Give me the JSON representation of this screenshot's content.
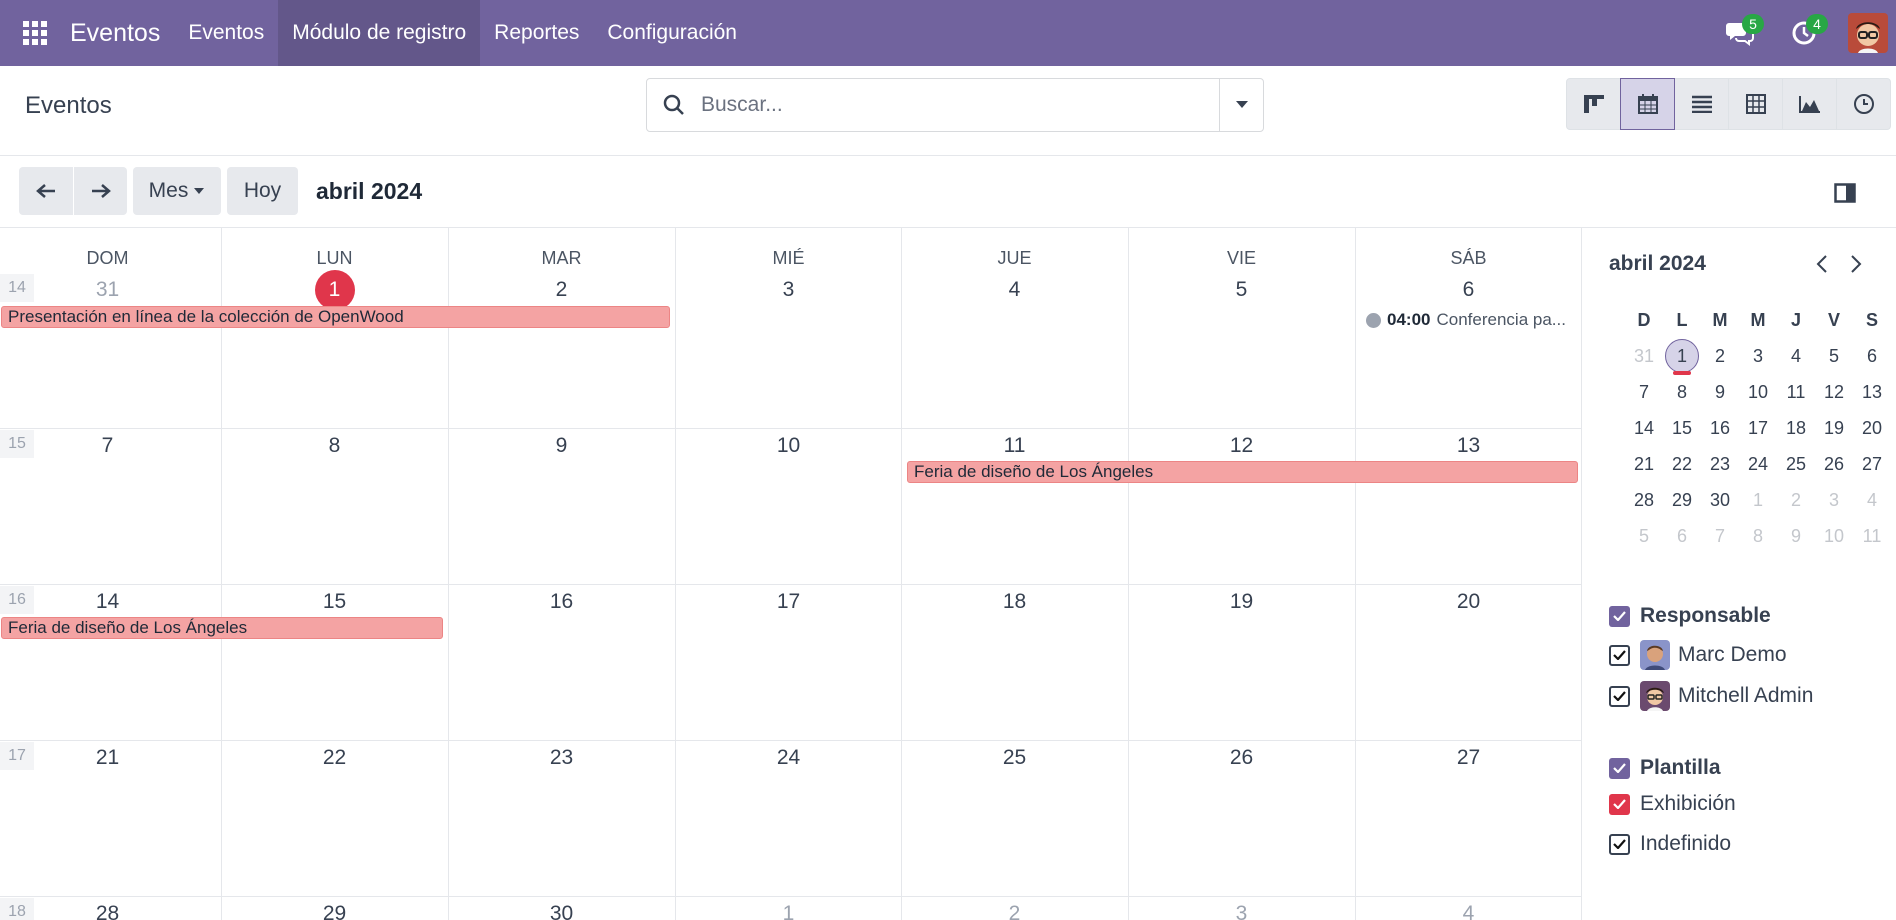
{
  "topnav": {
    "brand": "Eventos",
    "items": [
      "Eventos",
      "Módulo de registro",
      "Reportes",
      "Configuración"
    ],
    "active_index": 1,
    "messages_badge": "5",
    "activities_badge": "4",
    "bg_color": "#71639e"
  },
  "control": {
    "title": "Eventos",
    "search_placeholder": "Buscar...",
    "views": [
      "kanban-view-icon",
      "calendar-view-icon",
      "list-view-icon",
      "pivot-view-icon",
      "graph-view-icon",
      "activity-view-icon"
    ],
    "active_view": "calendar-view-icon"
  },
  "toolbar": {
    "scale_label": "Mes",
    "today_label": "Hoy",
    "current_range": "abril 2024"
  },
  "calendar": {
    "weekdays": [
      "DOM",
      "LUN",
      "MAR",
      "MIÉ",
      "JUE",
      "VIE",
      "SÁB"
    ],
    "weeks": [
      {
        "num": "14",
        "days": [
          "31",
          "1",
          "2",
          "3",
          "4",
          "5",
          "6"
        ]
      },
      {
        "num": "15",
        "days": [
          "7",
          "8",
          "9",
          "10",
          "11",
          "12",
          "13"
        ]
      },
      {
        "num": "16",
        "days": [
          "14",
          "15",
          "16",
          "17",
          "18",
          "19",
          "20"
        ]
      },
      {
        "num": "17",
        "days": [
          "21",
          "22",
          "23",
          "24",
          "25",
          "26",
          "27"
        ]
      },
      {
        "num": "18",
        "days": [
          "28",
          "29",
          "30",
          "1",
          "2",
          "3",
          "4"
        ]
      }
    ],
    "today": "1",
    "events": {
      "openwood": "Presentación en línea de la colección de OpenWood",
      "la_fair_1": "Feria de diseño de Los Ángeles",
      "la_fair_2": "Feria de diseño de Los Ángeles",
      "conf_time": "04:00",
      "conf_title": "Conferencia pa..."
    },
    "event_color": "#f4a3a3"
  },
  "sidebar": {
    "mini_title": "abril 2024",
    "mini_headers": [
      "D",
      "L",
      "M",
      "M",
      "J",
      "V",
      "S"
    ],
    "mini_weeks": [
      [
        "31",
        "1",
        "2",
        "3",
        "4",
        "5",
        "6"
      ],
      [
        "7",
        "8",
        "9",
        "10",
        "11",
        "12",
        "13"
      ],
      [
        "14",
        "15",
        "16",
        "17",
        "18",
        "19",
        "20"
      ],
      [
        "21",
        "22",
        "23",
        "24",
        "25",
        "26",
        "27"
      ],
      [
        "28",
        "29",
        "30",
        "1",
        "2",
        "3",
        "4"
      ],
      [
        "5",
        "6",
        "7",
        "8",
        "9",
        "10",
        "11"
      ]
    ],
    "responsable": {
      "label": "Responsable",
      "items": [
        "Marc Demo",
        "Mitchell Admin"
      ]
    },
    "plantilla": {
      "label": "Plantilla",
      "items": [
        "Exhibición",
        "Indefinido"
      ]
    }
  }
}
